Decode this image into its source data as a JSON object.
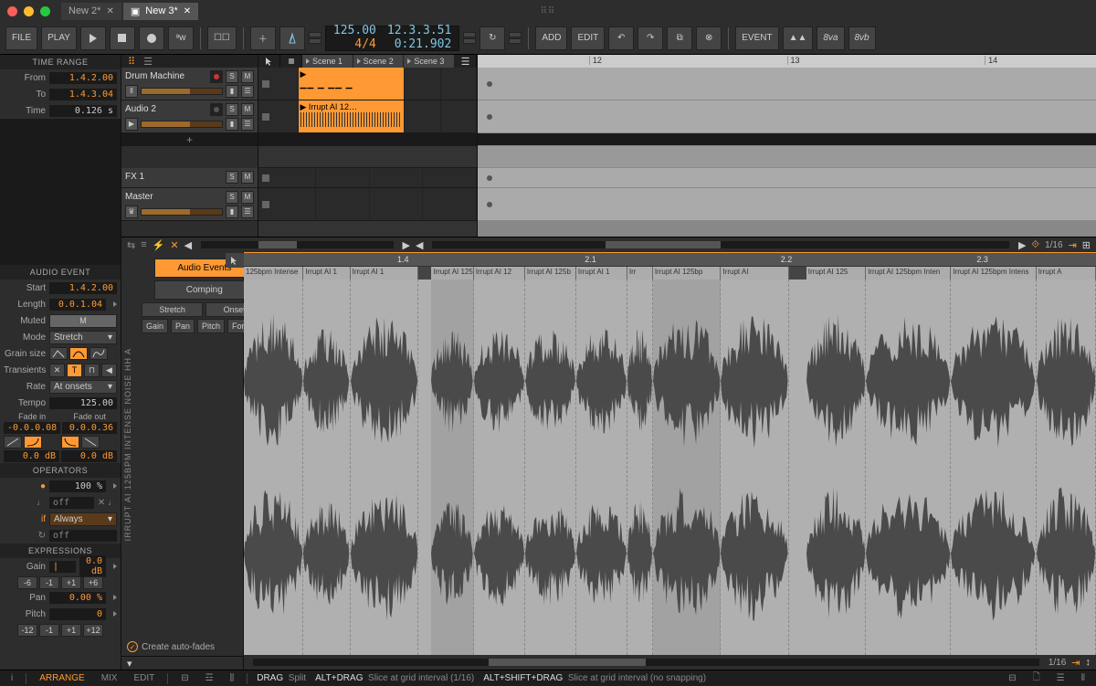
{
  "tabs": [
    {
      "label": "New 2*",
      "active": false
    },
    {
      "label": "New 3*",
      "active": true
    }
  ],
  "toolbar": {
    "file": "FILE",
    "play": "PLAY",
    "add": "ADD",
    "edit": "EDIT",
    "event": "EVENT"
  },
  "transport": {
    "tempo": "125.00",
    "sig": "4/4",
    "pos": "12.3.3.51",
    "time": "0:21.902"
  },
  "time_range": {
    "title": "TIME RANGE",
    "from_label": "From",
    "from": "1.4.2.00",
    "to_label": "To",
    "to": "1.4.3.04",
    "time_label": "Time",
    "time": "0.126 s"
  },
  "tracks": {
    "items": [
      {
        "name": "Drum Machine"
      },
      {
        "name": "Audio 2"
      }
    ],
    "fx": "FX 1",
    "master": "Master"
  },
  "clip_launcher": {
    "scenes": [
      "Scene 1",
      "Scene 2",
      "Scene 3"
    ],
    "clip_audio_name": "Irrupt AI 12…"
  },
  "timeline_ruler": [
    "12",
    "13",
    "14"
  ],
  "grid_label": "1/16",
  "audio_event": {
    "title": "AUDIO EVENT",
    "start_label": "Start",
    "start": "1.4.2.00",
    "length_label": "Length",
    "length": "0.0.1.04",
    "muted_label": "Muted",
    "muted_val": "M",
    "mode_label": "Mode",
    "mode_val": "Stretch",
    "grain_label": "Grain size",
    "trans_label": "Transients",
    "rate_label": "Rate",
    "rate_val": "At onsets",
    "tempo_label": "Tempo",
    "tempo_val": "125.00",
    "fadein_label": "Fade in",
    "fadein_val": "-0.0.0.08",
    "fadeout_label": "Fade out",
    "fadeout_val": "0.0.0.36",
    "gain_db_l": "0.0 dB",
    "gain_db_r": "0.0 dB"
  },
  "operators": {
    "title": "OPERATORS",
    "chance": "100 %",
    "off1": "off",
    "always": "Always",
    "off2": "off"
  },
  "expressions": {
    "title": "EXPRESSIONS",
    "gain_label": "Gain",
    "gain_val": "0.0 dB",
    "gain_steps": [
      "-6",
      "-1",
      "+1",
      "+6"
    ],
    "pan_label": "Pan",
    "pan_val": "0.00 %",
    "pitch_label": "Pitch",
    "pitch_val": "0",
    "pitch_steps": [
      "-12",
      "-1",
      "+1",
      "+12"
    ]
  },
  "detail": {
    "track_label": "IRRUPT AI 125BPM INTENSE NOISE HH A",
    "tabs": {
      "audio_events": "Audio Events",
      "comping": "Comping"
    },
    "sub": {
      "stretch": "Stretch",
      "onsets": "Onsets"
    },
    "params": [
      "Gain",
      "Pan",
      "Pitch",
      "Formant"
    ],
    "auto_fades": "Create auto-fades",
    "ruler": [
      "1.4",
      "2.1",
      "2.2",
      "2.3"
    ],
    "slices": [
      {
        "l": 0,
        "w": 7,
        "t": "125bpm Intense"
      },
      {
        "l": 7,
        "w": 5.5,
        "t": "Irrupt AI 1"
      },
      {
        "l": 12.5,
        "w": 8,
        "t": "Irrupt AI 1"
      },
      {
        "l": 22,
        "w": 5,
        "t": "Irrupt AI 125"
      },
      {
        "l": 27,
        "w": 6,
        "t": "Irrupt AI 12"
      },
      {
        "l": 33,
        "w": 6,
        "t": "Irrupt AI 125b"
      },
      {
        "l": 39,
        "w": 6,
        "t": "Irrupt AI 1"
      },
      {
        "l": 45,
        "w": 3,
        "t": "Irr"
      },
      {
        "l": 48,
        "w": 8,
        "t": "Irrupt AI 125bp"
      },
      {
        "l": 56,
        "w": 8,
        "t": "Irrupt AI"
      },
      {
        "l": 66,
        "w": 7,
        "t": "Irrupt AI 125"
      },
      {
        "l": 73,
        "w": 10,
        "t": "Irrupt AI 125bpm Inten"
      },
      {
        "l": 83,
        "w": 10,
        "t": "Irrupt AI 125bpm Intens"
      },
      {
        "l": 93,
        "w": 7,
        "t": "Irrupt A"
      }
    ]
  },
  "footer": {
    "item_i": "i",
    "arrange": "ARRANGE",
    "mix": "MIX",
    "edit": "EDIT",
    "drag_label": "DRAG",
    "drag_action": "Split",
    "alt_label": "ALT+DRAG",
    "alt_action": "Slice at grid interval (1/16)",
    "altshift_label": "ALT+SHIFT+DRAG",
    "altshift_action": "Slice at grid interval (no snapping)"
  }
}
